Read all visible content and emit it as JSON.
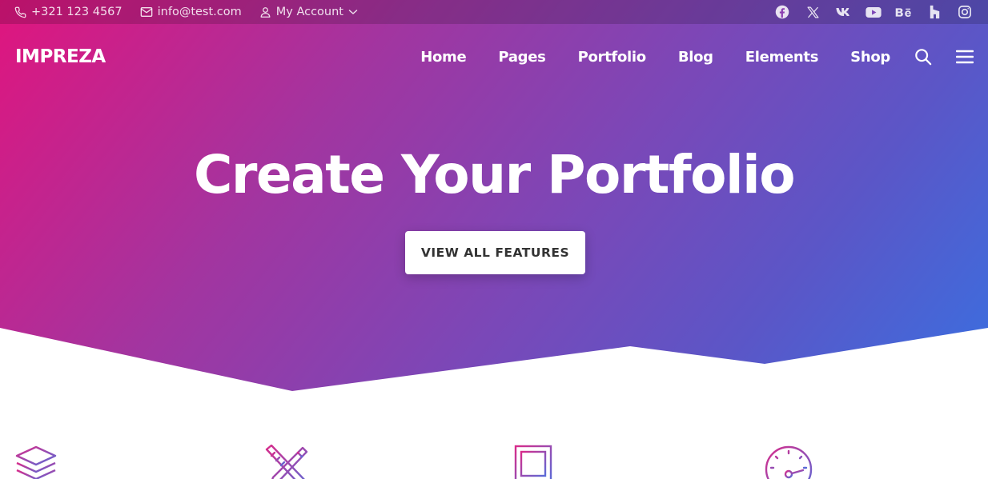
{
  "topbar": {
    "phone": "+321 123 4567",
    "email": "info@test.com",
    "account": "My Account",
    "icons": {
      "phone": "phone-icon",
      "email": "envelope-icon",
      "account": "user-icon",
      "account_chevron": "chevron-down-icon"
    },
    "social": [
      "facebook-icon",
      "x-twitter-icon",
      "vk-icon",
      "youtube-icon",
      "behance-icon",
      "houzz-icon",
      "instagram-icon"
    ]
  },
  "header": {
    "logo": "IMPREZA",
    "nav": [
      {
        "label": "Home"
      },
      {
        "label": "Pages"
      },
      {
        "label": "Portfolio"
      },
      {
        "label": "Blog"
      },
      {
        "label": "Elements"
      },
      {
        "label": "Shop"
      }
    ],
    "icons": [
      "search-icon",
      "menu-icon"
    ]
  },
  "hero": {
    "title": "Create Your Portfolio",
    "cta_label": "VIEW ALL FEATURES",
    "gradient": [
      "#e0157e",
      "#a235a0",
      "#5b56c7",
      "#3a6fe0"
    ]
  },
  "features": {
    "icons": [
      "layers-icon",
      "pencil-ruler-icon",
      "frame-icon",
      "speedometer-icon"
    ],
    "gradient": [
      "#d82b8a",
      "#5a6bd8"
    ]
  },
  "colors": {
    "accent_start": "#e0157e",
    "accent_end": "#3a6fe0",
    "white": "#ffffff",
    "cta_text": "#333333"
  }
}
